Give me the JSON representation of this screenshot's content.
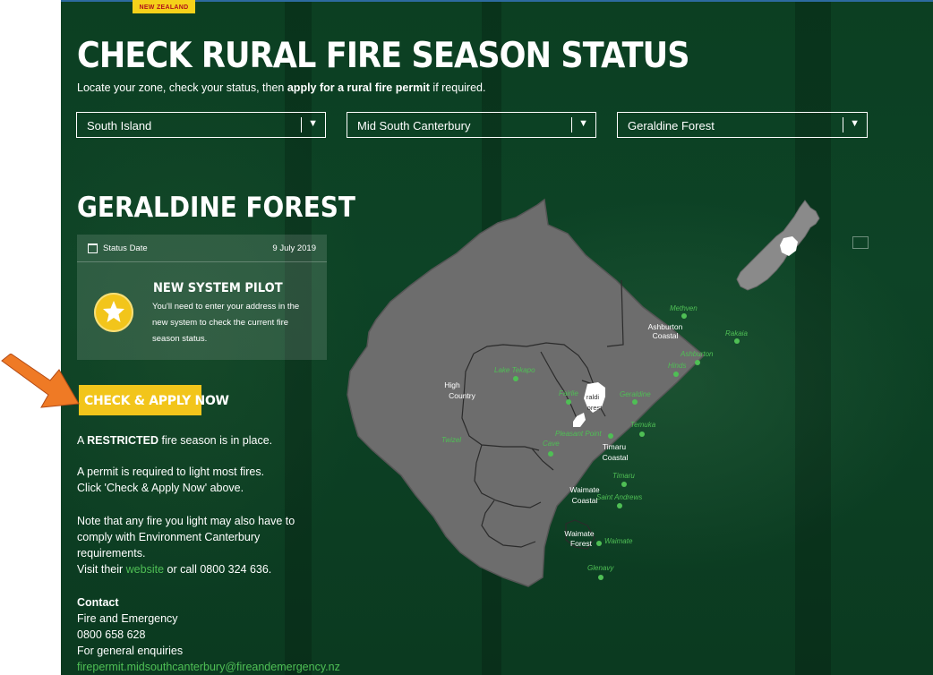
{
  "brand": {
    "tab_text": "NEW ZEALAND"
  },
  "header": {
    "title": "CHECK RURAL FIRE SEASON STATUS",
    "subtitle_pre": "Locate your zone, check your status, then ",
    "subtitle_bold": "apply for a rural fire permit",
    "subtitle_post": " if required."
  },
  "filters": {
    "island": "South Island",
    "district": "Mid South Canterbury",
    "zone": "Geraldine Forest",
    "arrow": "▼"
  },
  "zone": {
    "title": "GERALDINE FOREST"
  },
  "status_card": {
    "date_label": "Status Date",
    "date_value": "9 July 2019",
    "pilot_title": "NEW SYSTEM PILOT",
    "pilot_text": "You'll need to enter your address in the new system to check the current fire season status."
  },
  "cta": {
    "label": "CHECK & APPLY NOW"
  },
  "season": {
    "line_pre": "A ",
    "line_bold": "RESTRICTED",
    "line_post": " fire season is in place."
  },
  "permit": {
    "line1": "A permit is required to light most fires.",
    "line2": "Click 'Check & Apply Now' above."
  },
  "note": {
    "line1": "Note that any fire you light may also have to comply with Environment Canterbury requirements.",
    "visit_pre": "Visit their ",
    "visit_link": "website",
    "visit_post": " or call 0800 324 636."
  },
  "contact": {
    "title": "Contact",
    "org": "Fire and Emergency",
    "phone": "0800 658 628",
    "enquiries": "For general enquiries",
    "email": "firepermit.midsouthcanterbury@fireandemergency.nz"
  },
  "map": {
    "zones": [
      "High",
      "Country",
      "Ashburton",
      "Coastal",
      "Timaru",
      "Coastal",
      "Waimate",
      "Coastal",
      "Waimate",
      "Forest",
      "raldi",
      "orest"
    ],
    "towns": [
      "Methven",
      "Rakaia",
      "Ashburton",
      "Hinds",
      "Lake Tekapo",
      "Fairlie",
      "Geraldine",
      "Temuka",
      "Pleasant Point",
      "Cave",
      "Twizel",
      "Timaru",
      "Saint Andrews",
      "Waimate",
      "Glenavy"
    ]
  },
  "colors": {
    "background": "#0d4326",
    "accent_yellow": "#f2c51b",
    "map_fill": "#6d6d6d",
    "town_green": "#4fbf55",
    "arrow_orange": "#ef7a25"
  }
}
